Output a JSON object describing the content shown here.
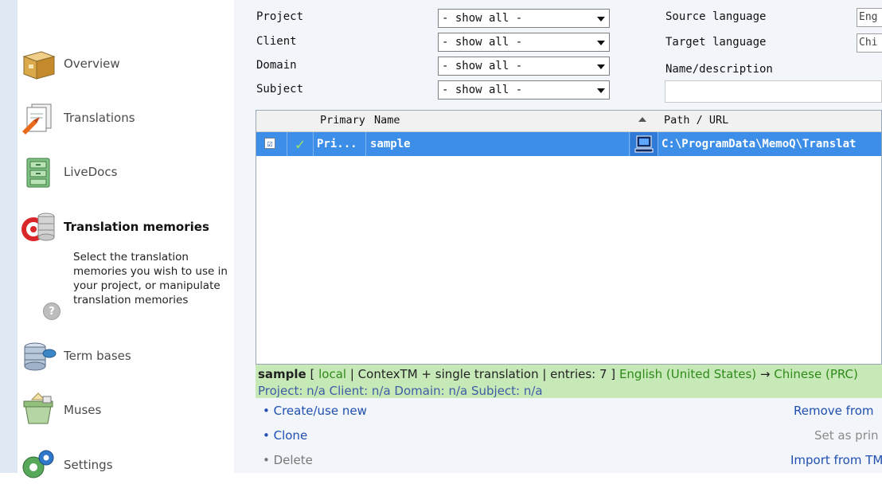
{
  "sidebar": {
    "items": [
      {
        "label": "Overview",
        "icon": "box-icon"
      },
      {
        "label": "Translations",
        "icon": "documents-icon"
      },
      {
        "label": "LiveDocs",
        "icon": "cabinet-icon"
      },
      {
        "label": "Translation memories",
        "icon": "tm-database-icon"
      },
      {
        "label": "Term bases",
        "icon": "termbase-icon"
      },
      {
        "label": "Muses",
        "icon": "muse-icon"
      },
      {
        "label": "Settings",
        "icon": "gears-icon"
      }
    ],
    "active_description": "Select the translation memories you wish to use in your project, or manipulate translation memories",
    "help_label": "?"
  },
  "filters": {
    "project_label": "Project",
    "client_label": "Client",
    "domain_label": "Domain",
    "subject_label": "Subject",
    "project_value": "- show all -",
    "client_value": "- show all -",
    "domain_value": "- show all -",
    "subject_value": "- show all -",
    "source_language_label": "Source language",
    "target_language_label": "Target language",
    "name_description_label": "Name/description",
    "source_language_value": "Eng",
    "target_language_value": "Chi"
  },
  "grid": {
    "headers": {
      "primary": "Primary",
      "name": "Name",
      "path": "Path / URL"
    },
    "rows": [
      {
        "checked": "☑",
        "status": "✓",
        "primary": "Pri...",
        "name": "sample",
        "path": "C:\\ProgramData\\MemoQ\\Translat"
      }
    ]
  },
  "info": {
    "name": "sample",
    "location": "local",
    "details": " | ContexTM + single translation | entries: 7 ] ",
    "source_lang": "English (United States)",
    "arrow": " → ",
    "target_lang": "Chinese (PRC)",
    "meta": "Project: n/a  Client: n/a  Domain: n/a  Subject: n/a"
  },
  "actions": {
    "create": "• Create/use new",
    "clone": "• Clone",
    "delete": "• Delete",
    "remove": "Remove from",
    "set_primary": "Set as prin",
    "import": "Import from TM"
  }
}
